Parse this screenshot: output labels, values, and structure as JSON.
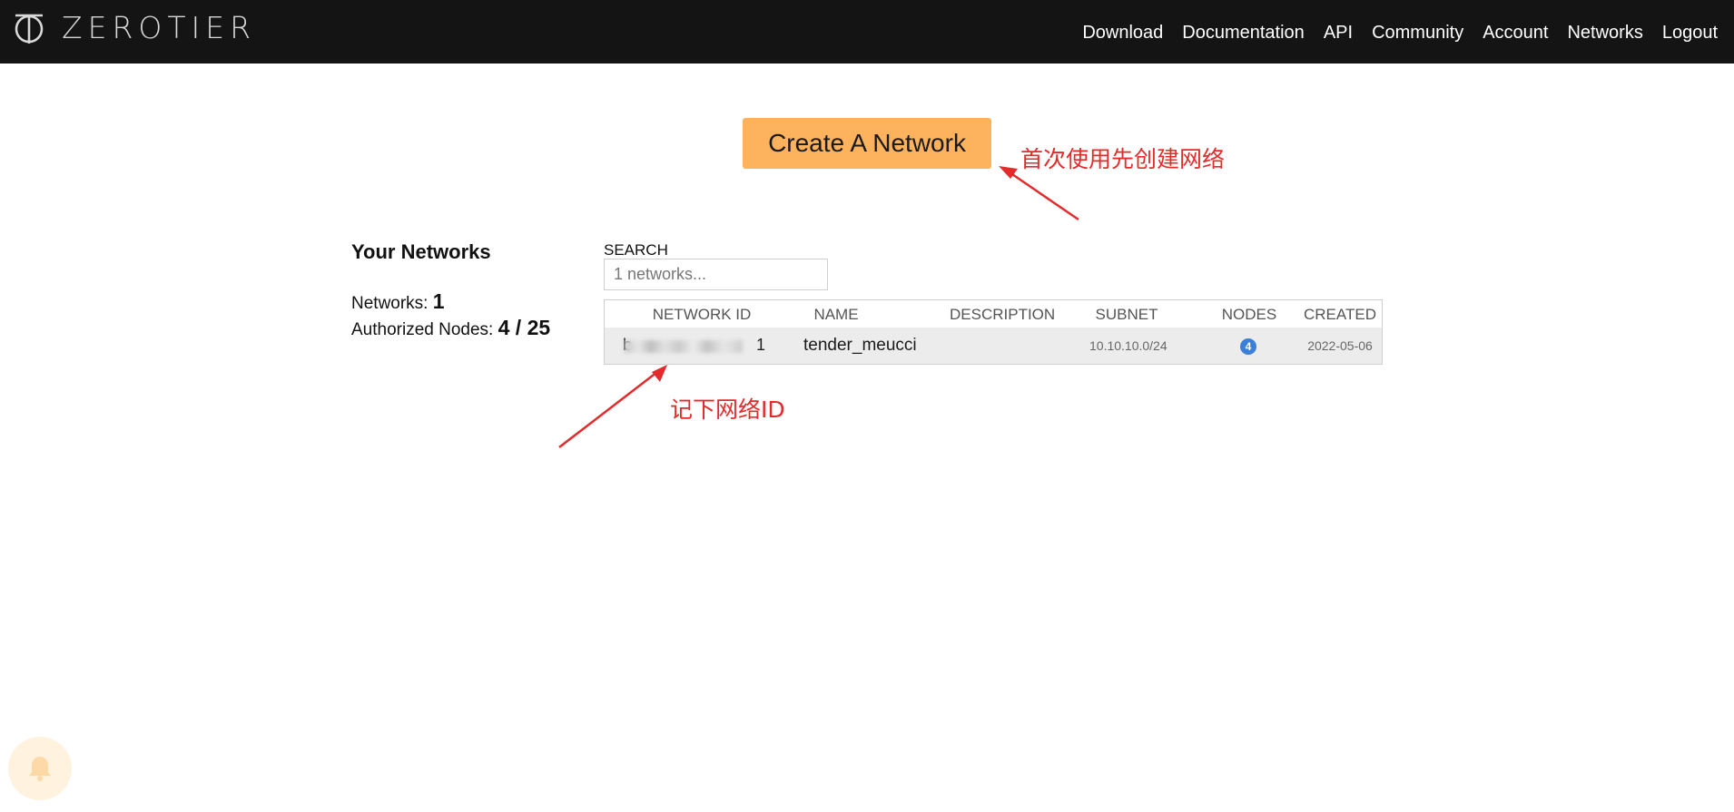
{
  "brand": {
    "name": "ZEROTIER"
  },
  "nav": [
    {
      "label": "Download"
    },
    {
      "label": "Documentation"
    },
    {
      "label": "API"
    },
    {
      "label": "Community"
    },
    {
      "label": "Account"
    },
    {
      "label": "Networks"
    },
    {
      "label": "Logout"
    }
  ],
  "create_button": {
    "label": "Create A Network"
  },
  "annotations": {
    "create_hint": "首次使用先创建网络",
    "id_hint": "记下网络ID",
    "color": "#e32b2b"
  },
  "summary": {
    "title": "Your Networks",
    "networks_label": "Networks:",
    "networks_value": "1",
    "nodes_label": "Authorized Nodes:",
    "nodes_value": "4 / 25"
  },
  "search": {
    "label": "SEARCH",
    "placeholder": "1 networks..."
  },
  "table": {
    "headers": [
      "NETWORK ID",
      "NAME",
      "DESCRIPTION",
      "SUBNET",
      "NODES",
      "CREATED"
    ],
    "rows": [
      {
        "network_id_start": "b",
        "network_id_end": "1",
        "name": "tender_meucci",
        "description": "",
        "subnet": "10.10.10.0/24",
        "nodes": "4",
        "created": "2022-05-06"
      }
    ]
  },
  "colors": {
    "topbar": "#141414",
    "create_button": "#fdb25d",
    "nodes_badge": "#3c7fd8",
    "row_background": "#ececec"
  }
}
